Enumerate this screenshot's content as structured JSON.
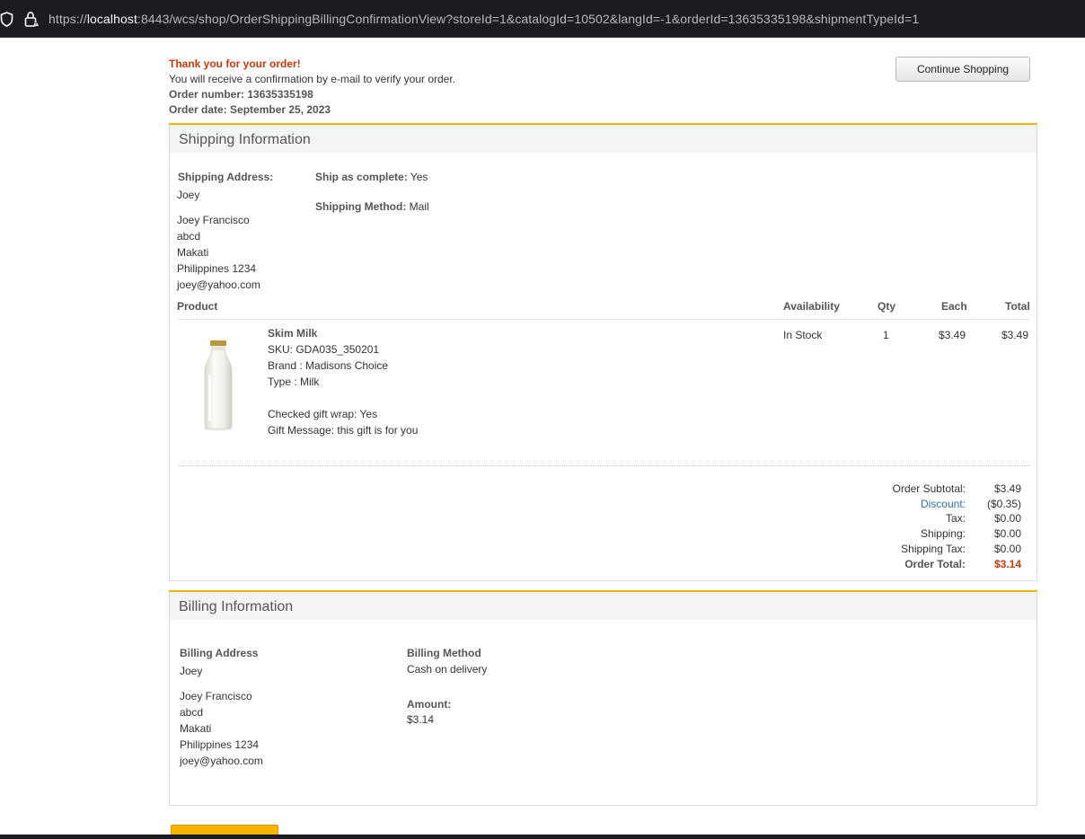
{
  "browser": {
    "url_proto": "https://",
    "url_host": "localhost",
    "url_rest": ":8443/wcs/shop/OrderShippingBillingConfirmationView?storeId=1&catalogId=10502&langId=-1&orderId=13635335198&shipmentTypeId=1"
  },
  "header": {
    "thank_you": "Thank you for your order!",
    "confirmation": "You will receive a confirmation by e-mail to verify your order.",
    "order_number": "Order number: 13635335198",
    "order_date": "Order date: September 25, 2023",
    "continue_label": "Continue Shopping"
  },
  "shipping": {
    "title": "Shipping Information",
    "address_label": "Shipping Address:",
    "nickname": "Joey",
    "address_lines": [
      "Joey Francisco",
      "abcd",
      "Makati",
      "Philippines 1234",
      "joey@yahoo.com"
    ],
    "ship_complete_label": "Ship as complete:",
    "ship_complete_value": "Yes",
    "method_label": "Shipping Method:",
    "method_value": "Mail"
  },
  "items_table": {
    "headers": {
      "product": "Product",
      "availability": "Availability",
      "qty": "Qty",
      "each": "Each",
      "total": "Total"
    },
    "item": {
      "name": "Skim Milk",
      "sku": "SKU: GDA035_350201",
      "brand": "Brand : Madisons Choice",
      "type": "Type : Milk",
      "gift_wrap": "Checked gift wrap: Yes",
      "gift_message": "Gift Message: this gift is for you",
      "availability": "In Stock",
      "qty": "1",
      "each": "$3.49",
      "total": "$3.49"
    }
  },
  "totals": {
    "subtotal_label": "Order Subtotal:",
    "subtotal": "$3.49",
    "discount_label": "Discount:",
    "discount": "($0.35)",
    "tax_label": "Tax:",
    "tax": "$0.00",
    "shipping_label": "Shipping:",
    "shipping": "$0.00",
    "shipping_tax_label": "Shipping Tax:",
    "shipping_tax": "$0.00",
    "order_total_label": "Order Total:",
    "order_total": "$3.14"
  },
  "billing": {
    "title": "Billing Information",
    "address_label": "Billing Address",
    "nickname": "Joey",
    "address_lines": [
      "Joey Francisco",
      "abcd",
      "Makati",
      "Philippines 1234",
      "joey@yahoo.com"
    ],
    "method_label": "Billing Method",
    "method_value": "Cash on delivery",
    "amount_label": "Amount:",
    "amount_value": "$3.14"
  },
  "colors": {
    "accent": "#f2b300",
    "alert": "#c7390a",
    "link": "#2d6fb5"
  }
}
